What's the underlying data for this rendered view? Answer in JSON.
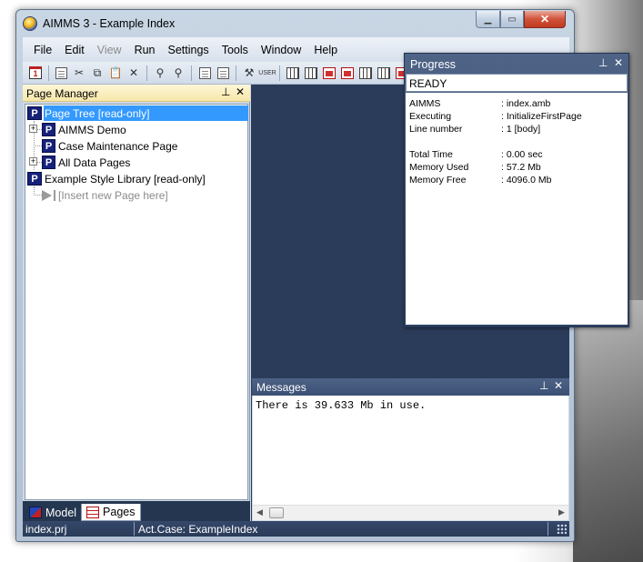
{
  "window": {
    "title": "AIMMS 3 - Example Index"
  },
  "menu": {
    "items": [
      "File",
      "Edit",
      "View",
      "Run",
      "Settings",
      "Tools",
      "Window",
      "Help"
    ],
    "disabled": [
      "View"
    ]
  },
  "toolbar": {
    "icons": [
      "calendar-icon",
      "copy-window-icon",
      "cut-icon",
      "copy-icon",
      "paste-icon",
      "delete-icon",
      "find-icon",
      "find-next-icon",
      "page-icon",
      "template-icon",
      "tools-icon",
      "user-icon",
      "identifier-icon",
      "model-icon",
      "pages-icon",
      "table-icon",
      "list-icon",
      "data-icon",
      "red-page-icon",
      "red-table-icon"
    ]
  },
  "page_manager": {
    "title": "Page Manager",
    "pin_glyph": "⊥",
    "close_glyph": "✕",
    "tree": {
      "root": {
        "icon_letter": "P",
        "label": "Page Tree [read-only]"
      },
      "children": [
        {
          "label": "AIMMS Demo",
          "icon_letter": "P",
          "expander": "+"
        },
        {
          "label": "Case Maintenance Page",
          "icon_letter": "P"
        },
        {
          "label": "All Data Pages",
          "icon_letter": "P",
          "expander": "+"
        }
      ],
      "library": {
        "icon_letter": "P",
        "label": "Example Style Library [read-only]"
      },
      "insert": "[Insert new Page here]"
    },
    "tabs": [
      {
        "label": "Model",
        "active": false
      },
      {
        "label": "Pages",
        "active": true
      }
    ]
  },
  "messages": {
    "title": "Messages",
    "text": "There is 39.633 Mb in use."
  },
  "progress": {
    "title": "Progress",
    "status": "READY",
    "rows": [
      {
        "key": "AIMMS",
        "value": ": index.amb"
      },
      {
        "key": "Executing",
        "value": ": InitializeFirstPage"
      },
      {
        "key": "Line number",
        "value": ": 1 [body]"
      },
      {
        "key": "Total Time",
        "value": ": 0.00 sec"
      },
      {
        "key": "Memory Used",
        "value": ": 57.2 Mb"
      },
      {
        "key": "Memory Free",
        "value": ": 4096.0 Mb"
      }
    ]
  },
  "statusbar": {
    "project": "index.prj",
    "case": "Act.Case: ExampleIndex"
  },
  "colors": {
    "workspace": "#2b3c5a",
    "selection": "#3399ff",
    "panel_header": "#f7e7a8",
    "page_icon": "#15217a"
  }
}
